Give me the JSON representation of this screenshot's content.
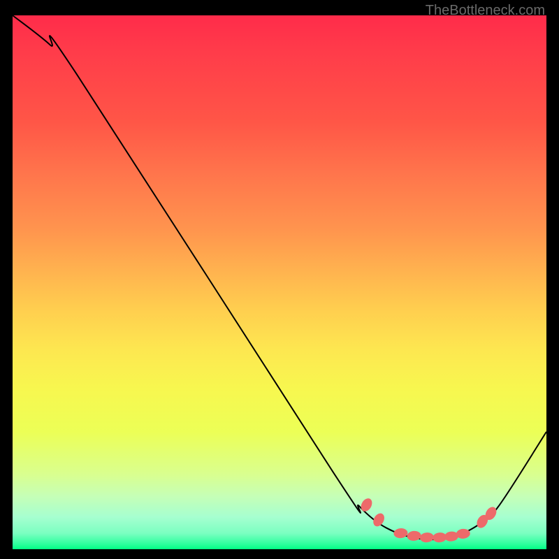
{
  "watermark": "TheBottleneck.com",
  "chart_data": {
    "type": "line",
    "title": "",
    "xlabel": "",
    "ylabel": "",
    "xlim": [
      0,
      100
    ],
    "ylim": [
      0,
      100
    ],
    "series": [
      {
        "name": "curve",
        "points": [
          {
            "x": 0,
            "y": 100
          },
          {
            "x": 7,
            "y": 94.5
          },
          {
            "x": 12,
            "y": 89
          },
          {
            "x": 60,
            "y": 14.5
          },
          {
            "x": 65,
            "y": 8
          },
          {
            "x": 70,
            "y": 4
          },
          {
            "x": 76,
            "y": 2
          },
          {
            "x": 82,
            "y": 2.2
          },
          {
            "x": 87,
            "y": 4.4
          },
          {
            "x": 91,
            "y": 8
          },
          {
            "x": 100,
            "y": 22
          }
        ]
      }
    ],
    "markers": [
      {
        "x": 66.3,
        "y": 8.3
      },
      {
        "x": 68.6,
        "y": 5.5
      },
      {
        "x": 72.7,
        "y": 3.0
      },
      {
        "x": 75.2,
        "y": 2.5
      },
      {
        "x": 77.6,
        "y": 2.2
      },
      {
        "x": 80.0,
        "y": 2.2
      },
      {
        "x": 82.2,
        "y": 2.4
      },
      {
        "x": 84.4,
        "y": 2.9
      },
      {
        "x": 88.0,
        "y": 5.2
      },
      {
        "x": 89.6,
        "y": 6.7
      }
    ],
    "marker_style": {
      "color": "#ed6a6a",
      "rx": 7,
      "ry": 10,
      "rotation_deg": 15
    }
  },
  "colors": {
    "background": "#000000",
    "curve": "#000000",
    "marker": "#ed6a6a",
    "watermark": "#6a6a6a",
    "gradient_top": "#ff2b4a",
    "gradient_bottom": "#00ff84"
  }
}
